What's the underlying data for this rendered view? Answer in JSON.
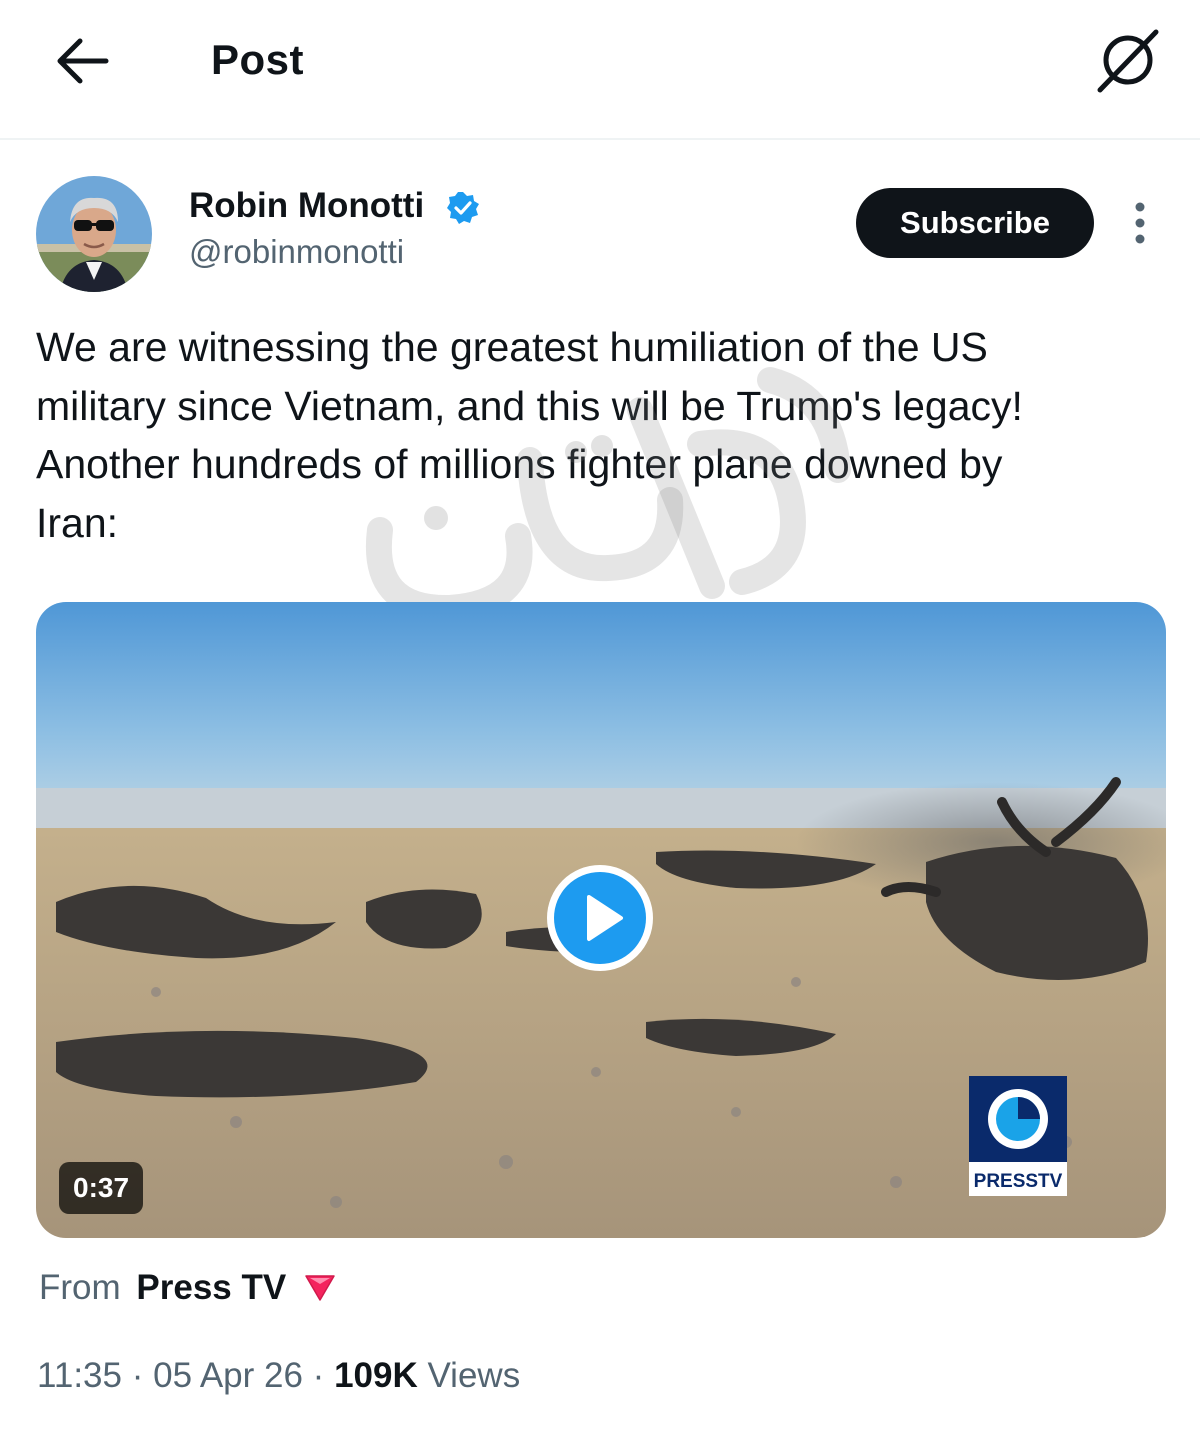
{
  "header": {
    "title": "Post"
  },
  "author": {
    "name": "Robin Monotti",
    "handle": "@robinmonotti",
    "verified": true,
    "subscribe_label": "Subscribe"
  },
  "tweet": {
    "text": "We are witnessing the greatest humiliation of the US\nmilitary since Vietnam, and this will be Trump's legacy!\nAnother hundreds of millions fighter plane downed by\nIran:"
  },
  "watermark": {
    "text": "روزنامه فرهیختگان"
  },
  "media": {
    "duration": "0:37",
    "channel_logo_text": "PRESSTV"
  },
  "source": {
    "prefix": "From",
    "name": "Press TV"
  },
  "meta": {
    "time": "11:35",
    "date": "05 Apr 26",
    "separator": " · ",
    "views_count": "109K",
    "views_label": "Views"
  },
  "colors": {
    "accent": "#1d9bf0",
    "text_primary": "#0f1419",
    "text_secondary": "#536471",
    "flag_red": "#f4245e"
  },
  "icons": {
    "back": "arrow-left-icon",
    "grok": "grok-icon",
    "verified": "verified-badge-icon",
    "more": "more-vertical-icon",
    "play": "play-icon",
    "flag": "red-triangle-icon"
  }
}
